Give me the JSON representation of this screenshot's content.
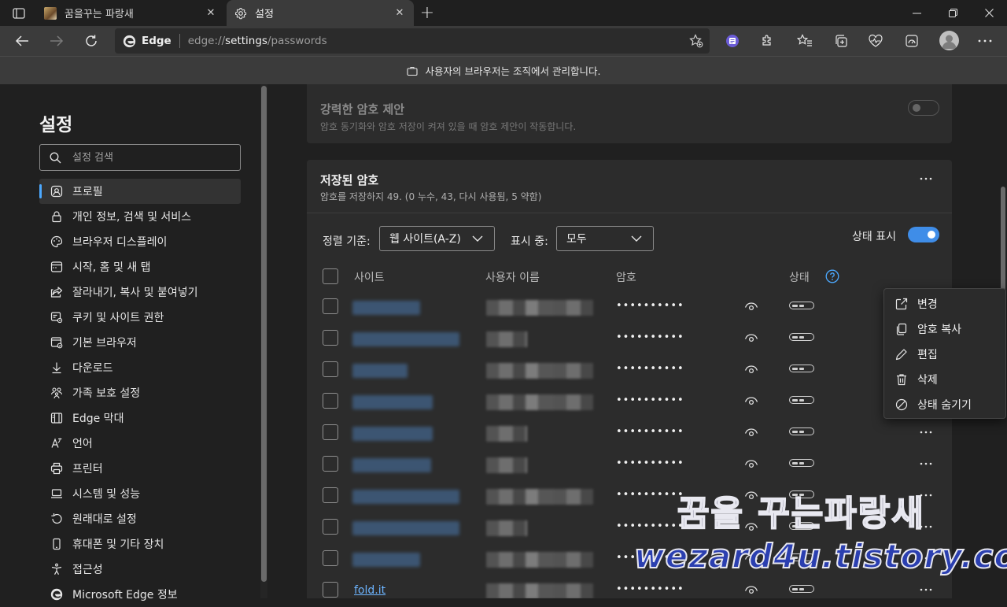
{
  "tabs": [
    {
      "label": "꿈을꾸는 파랑새",
      "active": false
    },
    {
      "label": "설정",
      "active": true
    }
  ],
  "address": {
    "brand": "Edge",
    "url_scheme": "edge://",
    "url_host": "settings",
    "url_path": "/passwords"
  },
  "banner": {
    "text": "사용자의 브라우저는 조직에서 관리합니다."
  },
  "sidebar": {
    "title": "설정",
    "search_placeholder": "설정 검색",
    "items": [
      {
        "label": "프로필",
        "icon": "profile-icon",
        "active": true
      },
      {
        "label": "개인 정보, 검색 및 서비스",
        "icon": "lock-icon"
      },
      {
        "label": "브라우저 디스플레이",
        "icon": "palette-icon"
      },
      {
        "label": "시작, 홈 및 새 탭",
        "icon": "start-page-icon"
      },
      {
        "label": "잘라내기, 복사 및 붙여넣기",
        "icon": "share-icon"
      },
      {
        "label": "쿠키 및 사이트 권한",
        "icon": "site-permissions-icon"
      },
      {
        "label": "기본 브라우저",
        "icon": "default-browser-icon"
      },
      {
        "label": "다운로드",
        "icon": "download-icon"
      },
      {
        "label": "가족 보호 설정",
        "icon": "family-icon"
      },
      {
        "label": "Edge 막대",
        "icon": "edge-bar-icon"
      },
      {
        "label": "언어",
        "icon": "language-icon"
      },
      {
        "label": "프린터",
        "icon": "printer-icon"
      },
      {
        "label": "시스템 및 성능",
        "icon": "laptop-icon"
      },
      {
        "label": "원래대로 설정",
        "icon": "reset-icon"
      },
      {
        "label": "휴대폰 및 기타 장치",
        "icon": "phone-icon"
      },
      {
        "label": "접근성",
        "icon": "accessibility-icon"
      },
      {
        "label": "Microsoft Edge 정보",
        "icon": "edge-logo-icon"
      }
    ]
  },
  "suggest_card": {
    "title": "강력한 암호 제안",
    "description": "암호 동기화와 암호 저장이 켜져 있을 때 암호 제안이 작동합니다.",
    "toggle_on": false
  },
  "saved_passwords": {
    "title": "저장된 암호",
    "summary": "암호를 저장하지 49. (0 누수, 43, 다시 사용됨, 5 약함)",
    "sort_label": "정렬 기준:",
    "sort_value": "웹 사이트(A-Z)",
    "show_label": "표시 중:",
    "show_value": "모두",
    "status_label": "상태 표시",
    "status_toggle_on": true,
    "columns": {
      "site": "사이트",
      "username": "사용자 이름",
      "password": "암호",
      "status": "상태"
    },
    "rows": [
      {
        "site": "",
        "password": "••••••••••",
        "more": false
      },
      {
        "site": "",
        "password": "••••••••••",
        "more": false
      },
      {
        "site": "",
        "password": "••••••••••",
        "more": false
      },
      {
        "site": "",
        "password": "••••••••••",
        "more": false
      },
      {
        "site": "",
        "password": "••••••••••",
        "more": true
      },
      {
        "site": "",
        "password": "••••••••••",
        "more": true
      },
      {
        "site": "",
        "password": "••••••••••",
        "more": true
      },
      {
        "site": "",
        "password": "••••••••••",
        "more": true
      },
      {
        "site": "",
        "password": "••••••••••",
        "more": true
      },
      {
        "site": "fold.it",
        "password": "••••••••••",
        "more": true
      }
    ]
  },
  "context_menu": [
    {
      "label": "변경",
      "icon": "open-external-icon"
    },
    {
      "label": "암호 복사",
      "icon": "copy-icon"
    },
    {
      "label": "편집",
      "icon": "pencil-icon"
    },
    {
      "label": "삭제",
      "icon": "trash-icon"
    },
    {
      "label": "상태 숨기기",
      "icon": "hide-icon"
    }
  ],
  "watermark": {
    "line1": "꿈을 꾸는파랑새",
    "line2": "wezard4u.tistory.com"
  },
  "colors": {
    "accent": "#3f8de8",
    "link": "#6cb4ff"
  }
}
